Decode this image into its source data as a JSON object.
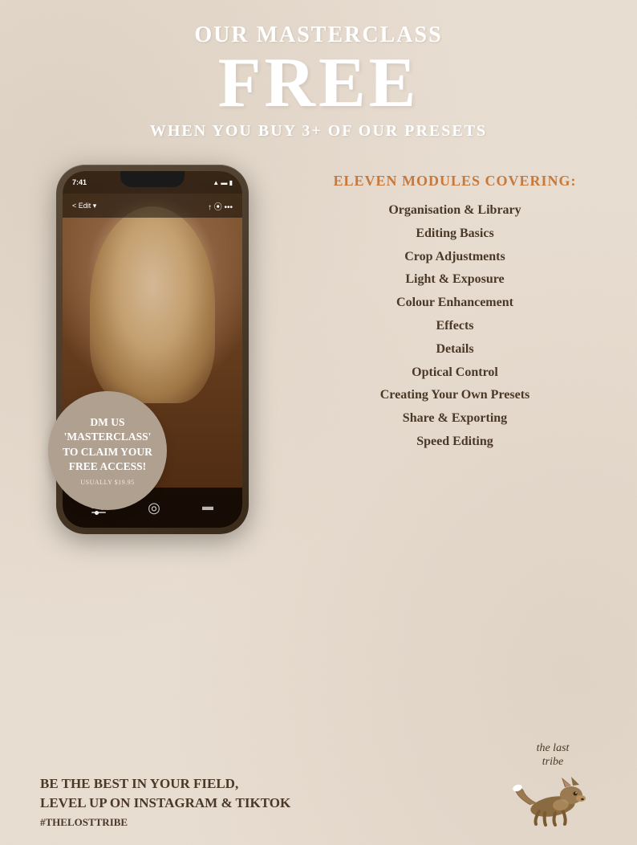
{
  "header": {
    "line1": "OUR MASTERCLASS",
    "line2": "FREE",
    "line3": "WHEN YOU BUY 3+ OF OUR PRESETS"
  },
  "phone": {
    "time": "7:41",
    "status_icons": "▲ ● ■",
    "edit_label": "< Edit ▾"
  },
  "dm_circle": {
    "main": "DM US\n'MASTERCLASS'\nTO CLAIM YOUR\nFREE ACCESS!",
    "sub": "USUALLY $19.95"
  },
  "modules": {
    "title": "ELEVEN MODULES COVERING:",
    "items": [
      "Organisation & Library",
      "Editing Basics",
      "Crop Adjustments",
      "Light & Exposure",
      "Colour Enhancement",
      "Effects",
      "Details",
      "Optical Control",
      "Creating Your Own Presets",
      "Share & Exporting",
      "Speed Editing"
    ]
  },
  "bottom": {
    "line1": "BE THE BEST IN YOUR FIELD,",
    "line2": "LEVEL UP ON INSTAGRAM & TIKTOK",
    "hashtag": "#THELOSTTRIBE"
  },
  "brand": {
    "name_line1": "the last",
    "name_line2": "tribe"
  }
}
